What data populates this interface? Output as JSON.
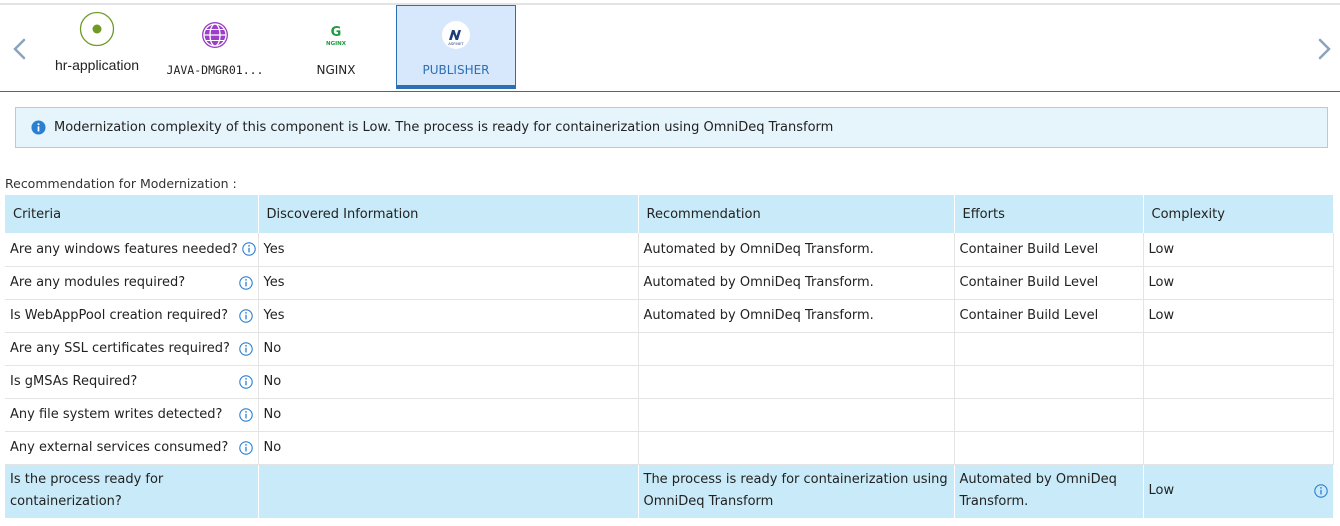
{
  "tabs": [
    {
      "label": "hr-application",
      "icon": "status-dot-icon"
    },
    {
      "label": "JAVA-DMGR01...",
      "icon": "globe-icon"
    },
    {
      "label": "NGINX",
      "icon": "nginx-logo-icon",
      "logo_text": "NGINX"
    },
    {
      "label": "PUBLISHER",
      "icon": "aspnet-logo-icon",
      "logo_text": "ASP.NET",
      "active": true
    }
  ],
  "banner": {
    "text": "Modernization complexity of this component is Low. The process is ready for containerization using OmniDeq Transform",
    "icon": "info-icon"
  },
  "section_title": "Recommendation for Modernization :",
  "table": {
    "headers": [
      "Criteria",
      "Discovered Information",
      "Recommendation",
      "Efforts",
      "Complexity"
    ],
    "rows": [
      {
        "criteria": "Are any windows features needed?",
        "discovered": "Yes",
        "recommendation": "Automated by OmniDeq Transform.",
        "efforts": "Container Build Level",
        "complexity": "Low"
      },
      {
        "criteria": "Are any modules required?",
        "discovered": "Yes",
        "recommendation": "Automated by OmniDeq Transform.",
        "efforts": "Container Build Level",
        "complexity": "Low"
      },
      {
        "criteria": "Is WebAppPool creation required?",
        "discovered": "Yes",
        "recommendation": "Automated by OmniDeq Transform.",
        "efforts": "Container Build Level",
        "complexity": "Low"
      },
      {
        "criteria": "Are any SSL certificates required?",
        "discovered": "No",
        "recommendation": "",
        "efforts": "",
        "complexity": ""
      },
      {
        "criteria": "Is gMSAs Required?",
        "discovered": "No",
        "recommendation": "",
        "efforts": "",
        "complexity": ""
      },
      {
        "criteria": "Any file system writes detected?",
        "discovered": "No",
        "recommendation": "",
        "efforts": "",
        "complexity": ""
      },
      {
        "criteria": "Any external services consumed?",
        "discovered": "No",
        "recommendation": "",
        "efforts": "",
        "complexity": ""
      }
    ],
    "final_row": {
      "criteria": "Is the process ready for containerization?",
      "discovered": "",
      "recommendation": "The process is ready for containerization using OmniDeq Transform",
      "efforts": "Automated by OmniDeq Transform.",
      "complexity": "Low"
    }
  },
  "colors": {
    "accent": "#2c6fb4",
    "header_bg": "#c9eaf8",
    "banner_bg": "#e6f4fb",
    "active_tab_bg": "#d8e8fc",
    "status_green": "#6f9a25",
    "globe_purple": "#9b3fc6",
    "nginx_green": "#1e9a3f",
    "info_blue": "#2b7fd1"
  }
}
